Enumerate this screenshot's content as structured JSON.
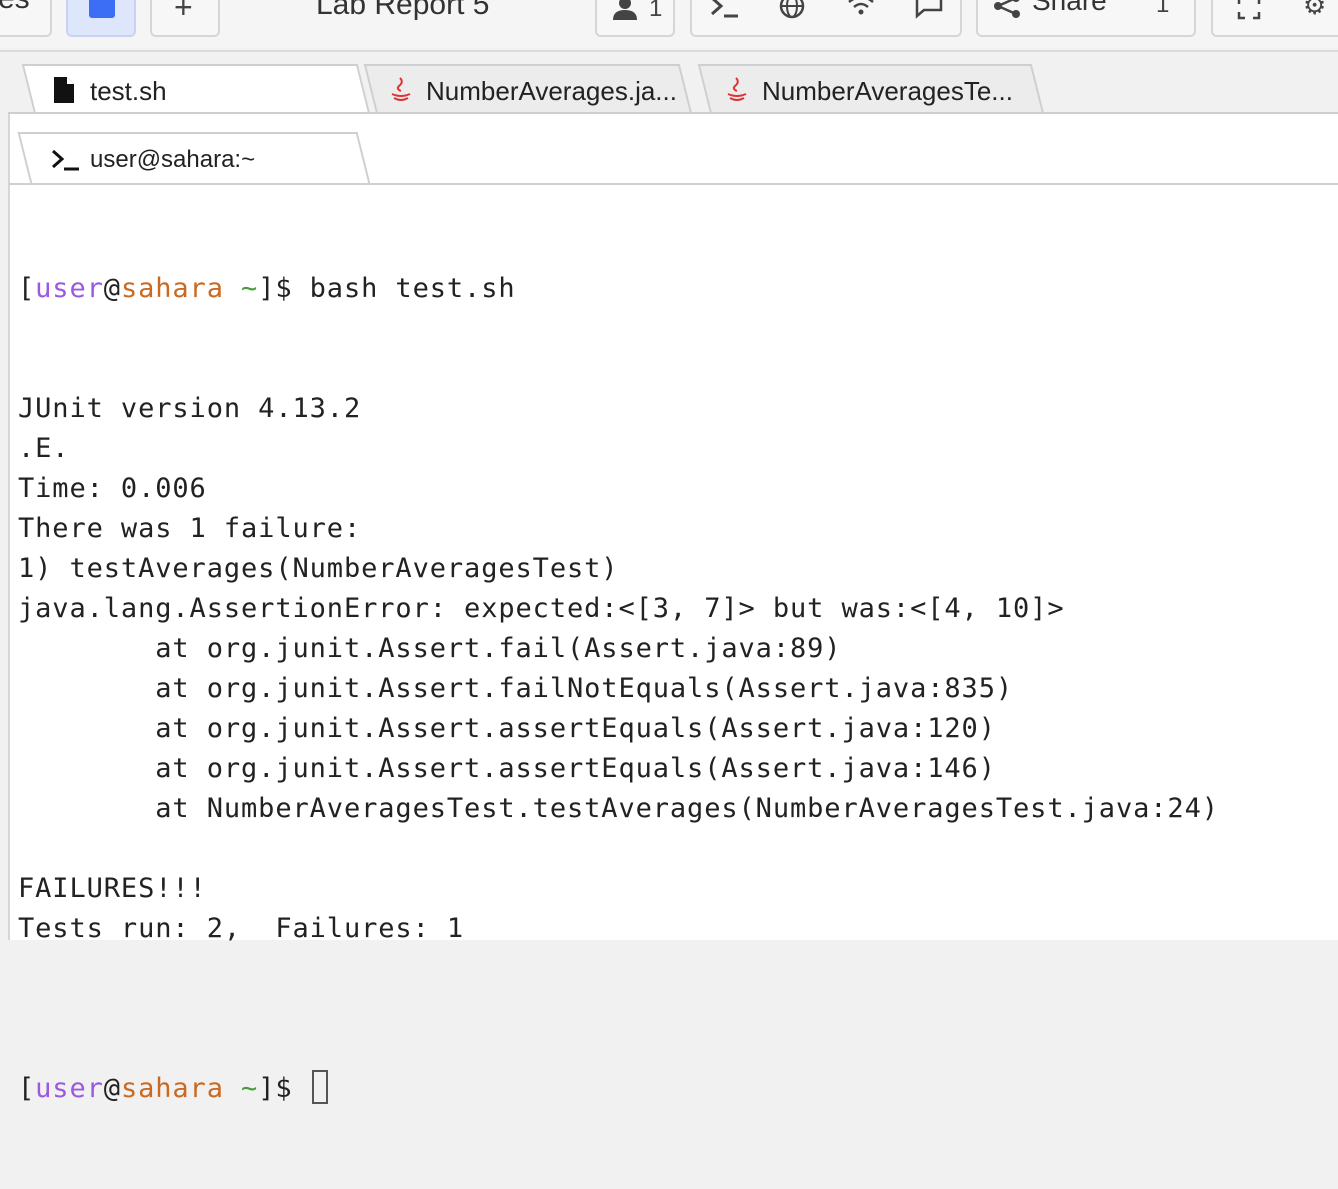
{
  "toolbar": {
    "left_partial_label": "es",
    "project_title": "Lab Report 5",
    "users_count": "1",
    "share_label": "Share",
    "branch_label": "1",
    "icons": [
      "files-icon",
      "plus-icon",
      "user-icon",
      "terminal-icon",
      "globe-icon",
      "wifi-icon",
      "chat-icon",
      "share-icon",
      "fullscreen-icon",
      "settings-icon"
    ],
    "accent_color": "#3b6ef5"
  },
  "file_tabs": [
    {
      "label": "test.sh",
      "icon": "file-icon",
      "active": true
    },
    {
      "label": "NumberAverages.ja...",
      "icon": "java-icon",
      "active": false
    },
    {
      "label": "NumberAveragesTe...",
      "icon": "java-icon",
      "active": false
    }
  ],
  "terminal_tab": {
    "label": "user@sahara:~",
    "icon": "terminal-prompt-icon"
  },
  "terminal": {
    "prompt": {
      "user": "user",
      "at": "@",
      "host": "sahara",
      "tilde": "~"
    },
    "command": "bash test.sh",
    "output": [
      "JUnit version 4.13.2",
      ".E.",
      "Time: 0.006",
      "There was 1 failure:",
      "1) testAverages(NumberAveragesTest)",
      "java.lang.AssertionError: expected:<[3, 7]> but was:<[4, 10]>",
      "        at org.junit.Assert.fail(Assert.java:89)",
      "        at org.junit.Assert.failNotEquals(Assert.java:835)",
      "        at org.junit.Assert.assertEquals(Assert.java:120)",
      "        at org.junit.Assert.assertEquals(Assert.java:146)",
      "        at NumberAveragesTest.testAverages(NumberAveragesTest.java:24)",
      "",
      "FAILURES!!!",
      "Tests run: 2,  Failures: 1",
      ""
    ],
    "colors": {
      "user": "#9b59e0",
      "host": "#c96a22",
      "tilde": "#4a9a3a"
    }
  }
}
